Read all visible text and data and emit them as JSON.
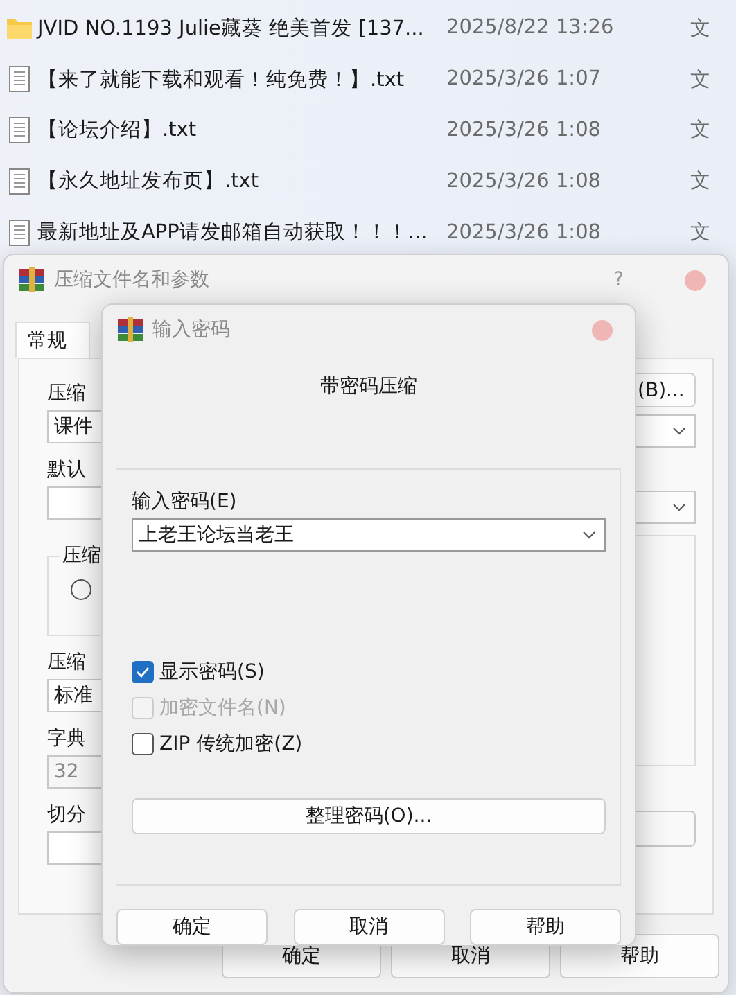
{
  "file_list": [
    {
      "kind": "folder",
      "name": "JVID NO.1193 Julie藏葵 绝美首发 [137...",
      "date": "2025/8/22 13:26",
      "column_3": "文"
    },
    {
      "kind": "text",
      "name": "【来了就能下载和观看！纯免费！】.txt",
      "date": "2025/3/26 1:07",
      "column_3": "文"
    },
    {
      "kind": "text",
      "name": "【论坛介绍】.txt",
      "date": "2025/3/26 1:08",
      "column_3": "文"
    },
    {
      "kind": "text",
      "name": "【永久地址发布页】.txt",
      "date": "2025/3/26 1:08",
      "column_3": "文"
    },
    {
      "kind": "text",
      "name": "最新地址及APP请发邮箱自动获取！！！...",
      "date": "2025/3/26 1:08",
      "column_3": "文"
    }
  ],
  "archive_dialog": {
    "title": "压缩文件名和参数",
    "help": "?",
    "tabs": [
      {
        "label": "常规",
        "selected": true
      }
    ],
    "archive_name_label": "压缩",
    "archive_name_value": "课件",
    "browse_button": "(B)...",
    "profile_label": "默认",
    "format_group_label": "压缩",
    "format_options": [
      {
        "selected": false
      }
    ],
    "method_label": "压缩",
    "method_value": "标准",
    "dictionary_label": "字典",
    "dictionary_value": "32",
    "split_label": "切分",
    "buttons": [
      "确定",
      "取消",
      "帮助"
    ]
  },
  "password_dialog": {
    "title": "输入密码",
    "heading": "带密码压缩",
    "password_label": "输入密码(E)",
    "password_value": "上老王论坛当老王",
    "options": [
      {
        "label": "显示密码(S)",
        "checked": true,
        "disabled": false
      },
      {
        "label": "加密文件名(N)",
        "checked": false,
        "disabled": true
      },
      {
        "label": "ZIP 传统加密(Z)",
        "checked": false,
        "disabled": false
      }
    ],
    "organize_button": "整理密码(O)...",
    "buttons": [
      "确定",
      "取消",
      "帮助"
    ]
  }
}
